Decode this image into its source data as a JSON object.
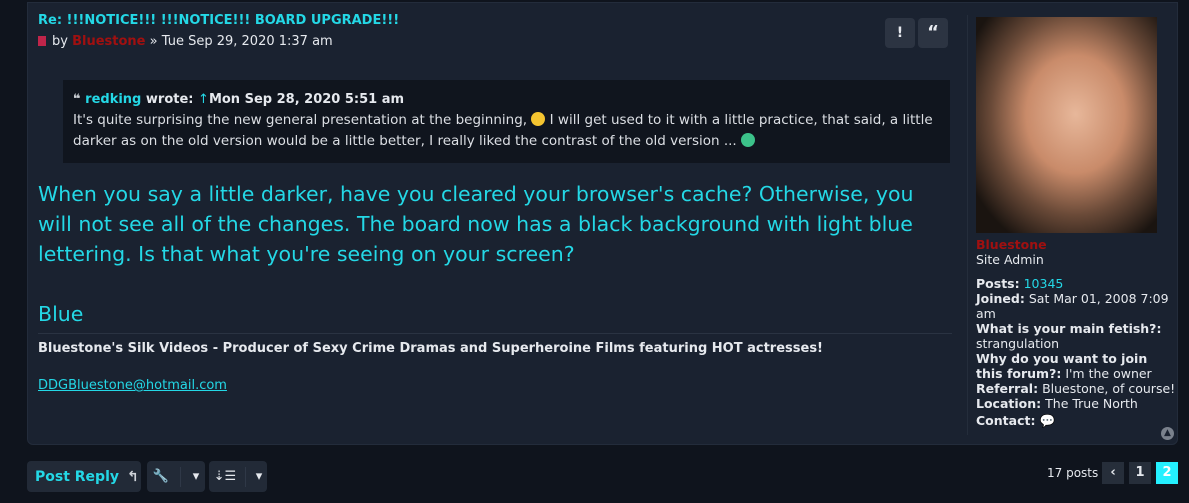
{
  "post": {
    "title": "Re: !!!NOTICE!!! !!!NOTICE!!! BOARD UPGRADE!!!",
    "by": "by",
    "author": "Bluestone",
    "sep": "»",
    "date": "Tue Sep 29, 2020 1:37 am",
    "report_label": "!",
    "quote_label": "“",
    "quote": {
      "user": "redking",
      "wrote": "wrote:",
      "arrow": "↑",
      "date": "Mon Sep 28, 2020 5:51 am",
      "text1": "It's quite surprising the new general presentation at the beginning,",
      "text2": " I will get used to it with a little practice, that said, a little darker as on the old version would be a little better, I really liked the contrast of the old version ... "
    },
    "body1": "When you say a little darker, have you cleared your browser's cache? Otherwise, you will not see all of the changes. The board now has a black background with light blue lettering. Is that what you're seeing on your screen?",
    "body2": "Blue",
    "signature": "Bluestone's Silk Videos - Producer of Sexy Crime Dramas and Superheroine Films featuring HOT actresses!",
    "email": "DDGBluestone@hotmail.com"
  },
  "profile": {
    "username": "Bluestone",
    "rank": "Site Admin",
    "posts_label": "Posts:",
    "posts": "10345",
    "joined_label": "Joined:",
    "joined": "Sat Mar 01, 2008 7:09 am",
    "fetish_label": "What is your main fetish?:",
    "fetish": "strangulation",
    "why_label": "Why do you want to join this forum?:",
    "why": "I'm the owner",
    "referral_label": "Referral:",
    "referral": "Bluestone, of course!",
    "location_label": "Location:",
    "location": "The True North",
    "contact_label": "Contact:"
  },
  "footer": {
    "post_reply": "Post Reply",
    "posts_count": "17 posts",
    "pages": [
      "1",
      "2"
    ],
    "current_page": "2"
  },
  "colors": {
    "accent": "#24d8e6",
    "username": "#a01010",
    "background": "#0f141d",
    "panel": "#1a2230"
  }
}
